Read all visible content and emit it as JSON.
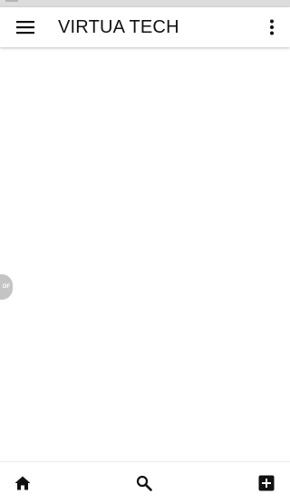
{
  "app_bar": {
    "title": "VIRTUA TECH",
    "menu_icon": "hamburger-menu-icon",
    "overflow_icon": "more-vert-icon"
  },
  "float_tab": {
    "label": "OF"
  },
  "bottom_nav": {
    "items": [
      {
        "icon": "home-icon"
      },
      {
        "icon": "search-icon"
      },
      {
        "icon": "add-box-icon"
      }
    ]
  },
  "colors": {
    "background": "#ffffff",
    "text": "#111111",
    "icon": "#111111",
    "status_bar": "#dcdcdc",
    "float_tab": "#c4c4c4"
  }
}
